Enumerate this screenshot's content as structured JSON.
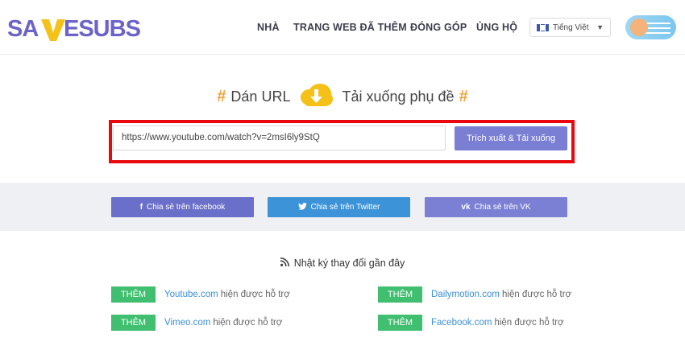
{
  "header": {
    "logo_text": "SAVESUBS",
    "nav": [
      "NHÀ",
      "TRANG WEB ĐÃ THÊM",
      "ĐÓNG GÓP",
      "ỦNG HỘ"
    ],
    "language": "Tiếng Việt",
    "language_icon": "flag-icon"
  },
  "hero": {
    "hash_left": "#",
    "paste_label": "Dán URL",
    "download_label": "Tải xuống phụ đề",
    "hash_right": "#",
    "url_value": "https://www.youtube.com/watch?v=2msI6ly9StQ",
    "extract_button": "Trích xuất & Tải xuống"
  },
  "share": [
    {
      "icon": "f",
      "label": "Chia sẻ trên facebook",
      "color": "#6a6fc9"
    },
    {
      "icon": "🐦",
      "label": "Chia sẻ trên Twitter",
      "color": "#3d93d8"
    },
    {
      "icon": "vk",
      "label": "Chia sẻ trên VK",
      "color": "#7b80d5"
    }
  ],
  "changelog": {
    "title": "Nhật ký thay đổi gần đây",
    "items": [
      {
        "badge": "THÊM",
        "site": "Youtube.com",
        "text": "hiện được hỗ trợ"
      },
      {
        "badge": "THÊM",
        "site": "Dailymotion.com",
        "text": "hiện được hỗ trợ"
      },
      {
        "badge": "THÊM",
        "site": "Vimeo.com",
        "text": "hiện được hỗ trợ"
      },
      {
        "badge": "THÊM",
        "site": "Facebook.com",
        "text": "hiện được hỗ trợ"
      }
    ]
  },
  "colors": {
    "accent": "#7b7fd4",
    "highlight_frame": "#e8080e",
    "badge": "#3fbf6f",
    "hash": "#f0a23a",
    "logo_purple": "#6b63c9",
    "logo_yellow": "#f5c118"
  }
}
